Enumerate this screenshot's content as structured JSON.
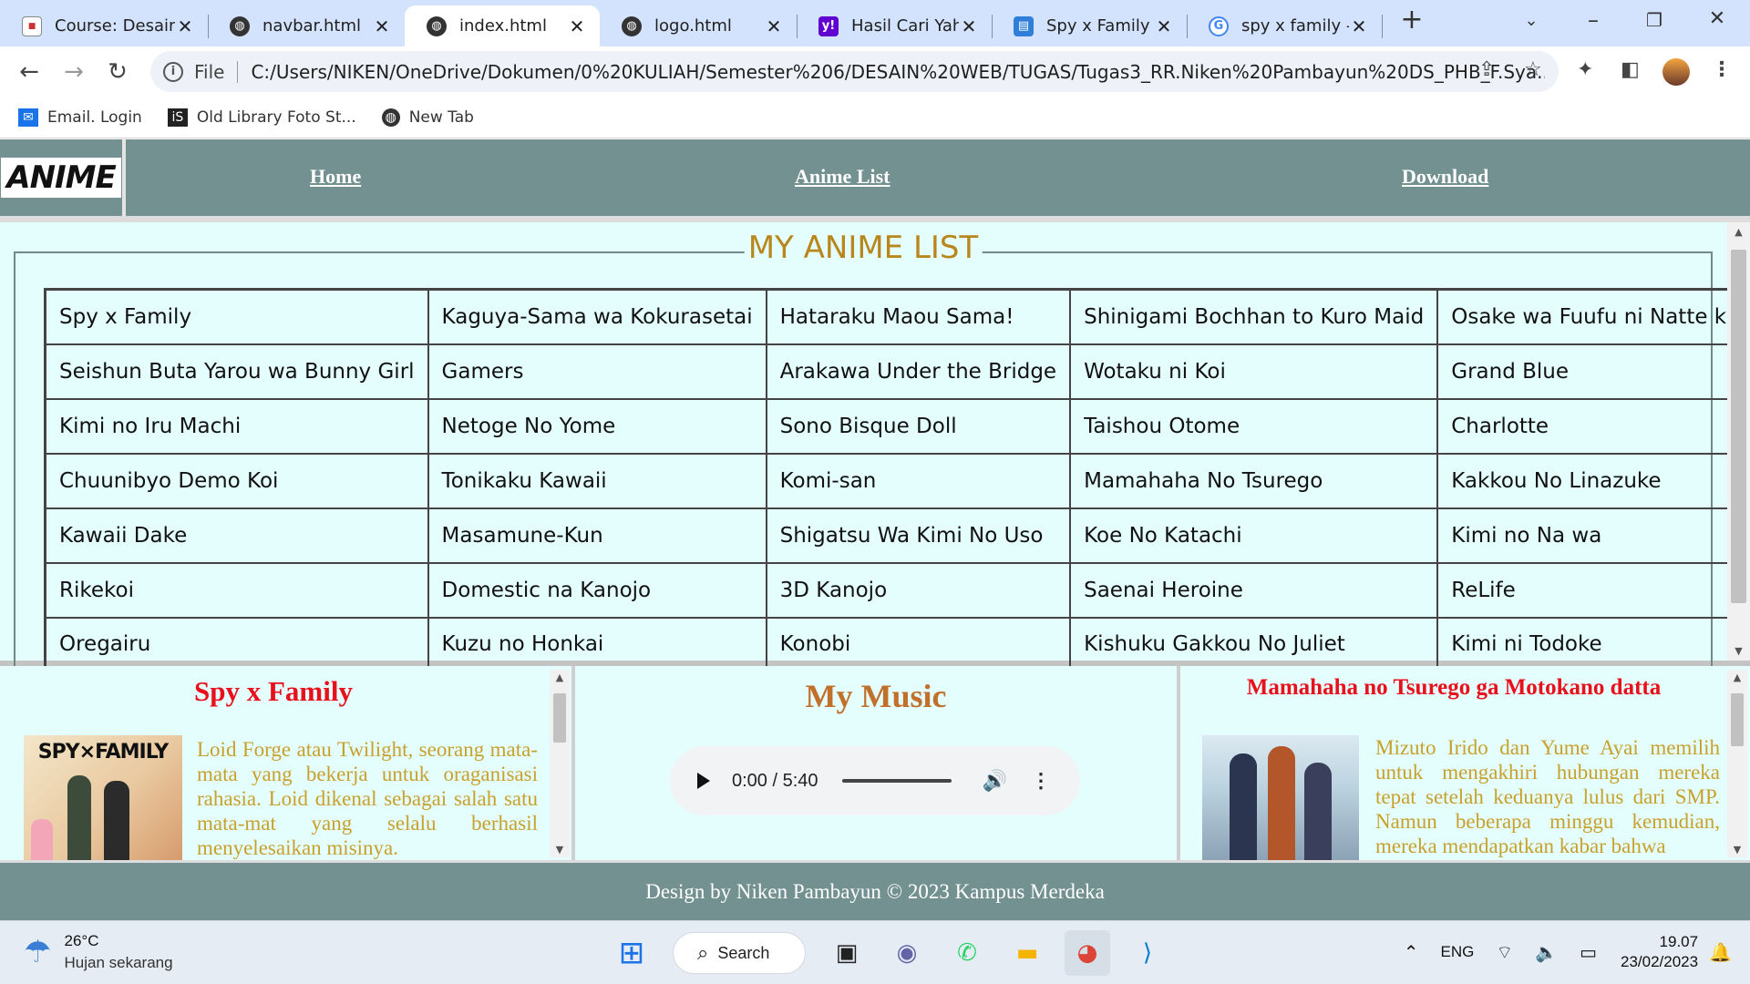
{
  "browser": {
    "tabs": [
      {
        "title": "Course: Desain",
        "favicon": "course-icon",
        "color": "#ffffff",
        "active": false
      },
      {
        "title": "navbar.html",
        "favicon": "globe-icon",
        "color": "#333333",
        "active": false
      },
      {
        "title": "index.html",
        "favicon": "globe-icon",
        "color": "#333333",
        "active": true
      },
      {
        "title": "logo.html",
        "favicon": "globe-icon",
        "color": "#333333",
        "active": false
      },
      {
        "title": "Hasil Cari Yaho",
        "favicon": "yahoo-icon",
        "color": "#6001d2",
        "active": false
      },
      {
        "title": "Spy x Family (E",
        "favicon": "page-icon",
        "color": "#2f7ed8",
        "active": false
      },
      {
        "title": "spy x family - G",
        "favicon": "google-icon",
        "color": "#4285f4",
        "active": false
      }
    ],
    "address": {
      "scheme": "File",
      "url": "C:/Users/NIKEN/OneDrive/Dokumen/0%20KULIAH/Semester%206/DESAIN%20WEB/TUGAS/Tugas3_RR.Niken%20Pambayun%20DS_PHB_F.Sya..."
    },
    "bookmarks": [
      {
        "label": "Email. Login",
        "icon": "mail-icon"
      },
      {
        "label": "Old Library Foto St...",
        "icon": "library-icon"
      },
      {
        "label": "New Tab",
        "icon": "globe-icon"
      }
    ]
  },
  "site": {
    "logo": "ANIME",
    "nav": [
      "Home",
      "Anime List",
      "Download"
    ],
    "list_title": "MY ANIME LIST",
    "anime_rows": [
      [
        "Spy x Family",
        "Kaguya-Sama wa Kokurasetai",
        "Hataraku Maou Sama!",
        "Shinigami Bochhan to Kuro Maid",
        "Osake wa Fuufu ni Natte kara"
      ],
      [
        "Seishun Buta Yarou wa Bunny Girl",
        "Gamers",
        "Arakawa Under the Bridge",
        "Wotaku ni Koi",
        "Grand Blue"
      ],
      [
        "Kimi no Iru Machi",
        "Netoge No Yome",
        "Sono Bisque Doll",
        "Taishou Otome",
        "Charlotte"
      ],
      [
        "Chuunibyo Demo Koi",
        "Tonikaku Kawaii",
        "Komi-san",
        "Mamahaha No Tsurego",
        "Kakkou No Linazuke"
      ],
      [
        "Kawaii Dake",
        "Masamune-Kun",
        "Shigatsu Wa Kimi No Uso",
        "Koe No Katachi",
        "Kimi no Na wa"
      ],
      [
        "Rikekoi",
        "Domestic na Kanojo",
        "3D Kanojo",
        "Saenai Heroine",
        "ReLife"
      ],
      [
        "Oregairu",
        "Kuzu no Honkai",
        "Konobi",
        "Kishuku Gakkou No Juliet",
        "Kimi ni Todoke"
      ]
    ],
    "left_panel": {
      "title": "Spy x Family",
      "image_text": "SPY×FAMILY",
      "text": "Loid Forge atau Twilight, seorang mata-mata yang bekerja untuk oraganisasi rahasia. Loid dikenal sebagai salah satu mata-mat yang selalu berhasil menyelesaikan misinya."
    },
    "middle_panel": {
      "title": "My Music",
      "time": "0:00 / 5:40"
    },
    "right_panel": {
      "title": "Mamahaha no Tsurego ga Motokano datta",
      "text": "Mizuto Irido dan Yume Ayai memilih untuk mengakhiri hubungan mereka tepat setelah keduanya lulus dari SMP. Namun beberapa minggu kemudian, mereka mendapatkan kabar bahwa"
    },
    "footer": "Design by Niken Pambayun © 2023 Kampus Merdeka"
  },
  "taskbar": {
    "weather_temp": "26°C",
    "weather_desc": "Hujan sekarang",
    "search_label": "Search",
    "lang": "ENG",
    "time": "19.07",
    "date": "23/02/2023"
  },
  "colors": {
    "navbar": "#739191",
    "content_bg": "#e4fefe",
    "title_gold": "#b8861b",
    "title_red": "#e8101a",
    "music_title": "#c0702a",
    "body_gold": "#c8a02c"
  }
}
